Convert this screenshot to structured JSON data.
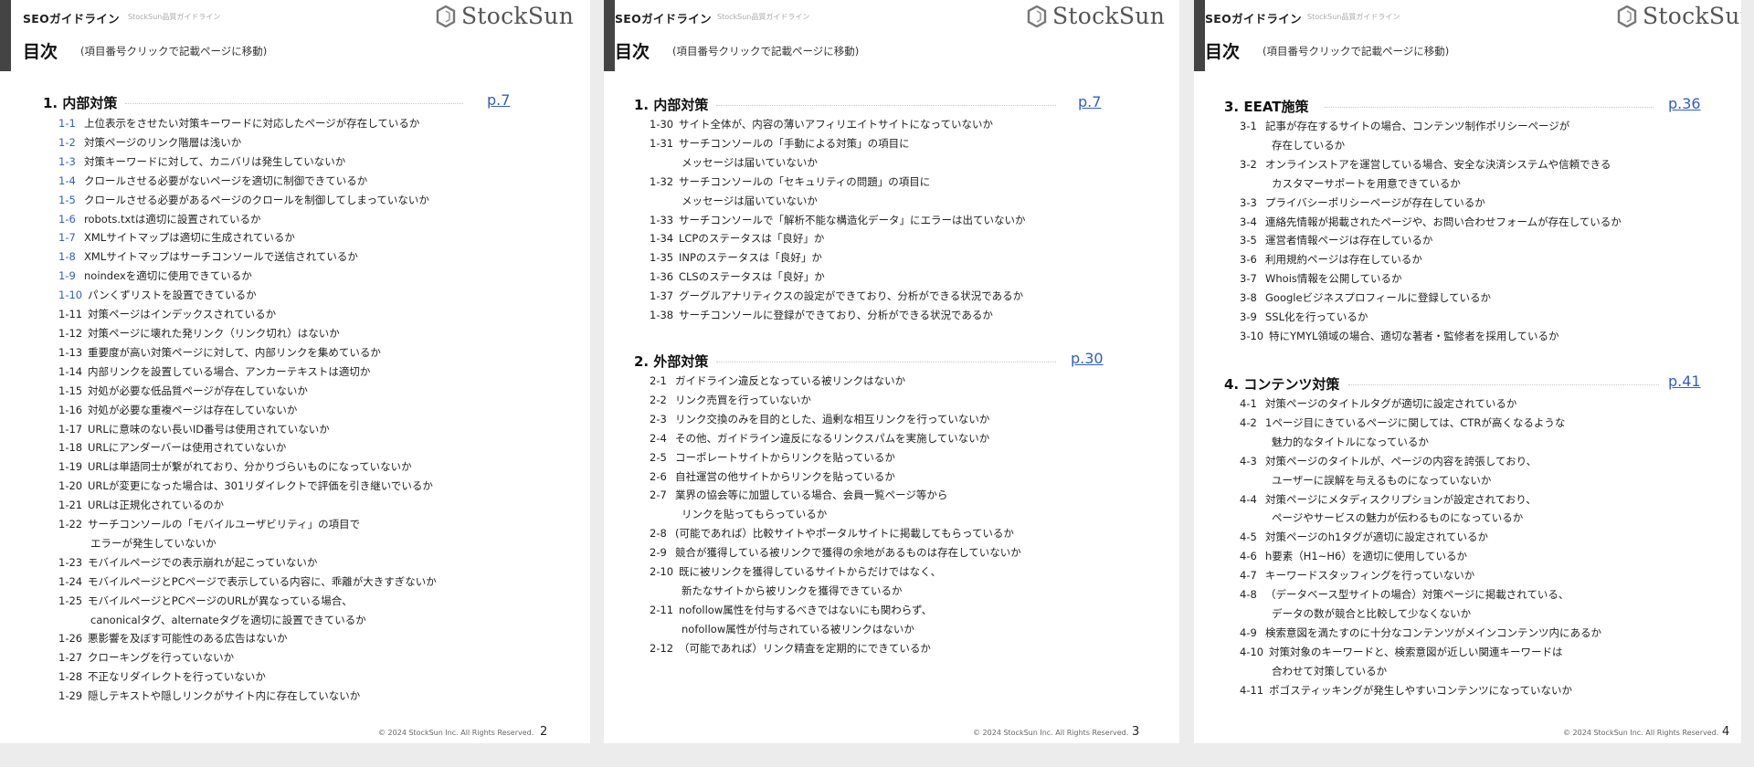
{
  "pages": [
    {
      "brand_title": "SEOガイドライン",
      "brand_sub": "StockSun品質ガイドライン",
      "logo_text": "StockSun",
      "heading": "目次",
      "heading_note": "(項目番号クリックで記載ページに移動)",
      "footer": "© 2024 StockSun Inc. All Rights Reserved.",
      "page_number": "2",
      "sections": [
        {
          "title": "1. 内部対策",
          "page": "p.7",
          "items": [
            {
              "num": "1-1",
              "text": "上位表示をさせたい対策キーワードに対応したページが存在しているか",
              "linked": true
            },
            {
              "num": "1-2",
              "text": "対策ページのリンク階層は浅いか",
              "linked": true
            },
            {
              "num": "1-3",
              "text": "対策キーワードに対して、カニバリは発生していないか",
              "linked": true
            },
            {
              "num": "1-4",
              "text": "クロールさせる必要がないページを適切に制御できているか",
              "linked": true
            },
            {
              "num": "1-5",
              "text": "クロールさせる必要があるページのクロールを制御してしまっていないか",
              "linked": true
            },
            {
              "num": "1-6",
              "text": "robots.txtは適切に設置されているか",
              "linked": true
            },
            {
              "num": "1-7",
              "text": "XMLサイトマップは適切に生成されているか",
              "linked": true
            },
            {
              "num": "1-8",
              "text": "XMLサイトマップはサーチコンソールで送信されているか",
              "linked": true
            },
            {
              "num": "1-9",
              "text": "noindexを適切に使用できているか",
              "linked": true
            },
            {
              "num": "1-10",
              "text": "パンくずリストを設置できているか",
              "linked": true
            },
            {
              "num": "1-11",
              "text": "対策ページはインデックスされているか",
              "linked": false
            },
            {
              "num": "1-12",
              "text": "対策ページに壊れた発リンク（リンク切れ）はないか",
              "linked": false
            },
            {
              "num": "1-13",
              "text": "重要度が高い対策ページに対して、内部リンクを集めているか",
              "linked": false
            },
            {
              "num": "1-14",
              "text": "内部リンクを設置している場合、アンカーテキストは適切か",
              "linked": false
            },
            {
              "num": "1-15",
              "text": "対処が必要な低品質ページが存在していないか",
              "linked": false
            },
            {
              "num": "1-16",
              "text": "対処が必要な重複ページは存在していないか",
              "linked": false
            },
            {
              "num": "1-17",
              "text": "URLに意味のない長いID番号は使用されていないか",
              "linked": false
            },
            {
              "num": "1-18",
              "text": "URLにアンダーバーは使用されていないか",
              "linked": false
            },
            {
              "num": "1-19",
              "text": "URLは単語同士が繋がれており、分かりづらいものになっていないか",
              "linked": false
            },
            {
              "num": "1-20",
              "text": "URLが変更になった場合は、301リダイレクトで評価を引き継いでいるか",
              "linked": false
            },
            {
              "num": "1-21",
              "text": "URLは正規化されているのか",
              "linked": false
            },
            {
              "num": "1-22",
              "text": "サーチコンソールの「モバイルユーザビリティ」の項目で",
              "linked": false
            },
            {
              "num": "",
              "text": "エラーが発生していないか",
              "linked": false
            },
            {
              "num": "1-23",
              "text": "モバイルページでの表示崩れが起こっていないか",
              "linked": false
            },
            {
              "num": "1-24",
              "text": "モバイルページとPCページで表示している内容に、乖離が大きすぎないか",
              "linked": false
            },
            {
              "num": "1-25",
              "text": "モバイルページとPCページのURLが異なっている場合、",
              "linked": false
            },
            {
              "num": "",
              "text": "canonicalタグ、alternateタグを適切に設置できているか",
              "linked": false
            },
            {
              "num": "1-26",
              "text": "悪影響を及ぼす可能性のある広告はないか",
              "linked": false
            },
            {
              "num": "1-27",
              "text": "クローキングを行っていないか",
              "linked": false
            },
            {
              "num": "1-28",
              "text": "不正なリダイレクトを行っていないか",
              "linked": false
            },
            {
              "num": "1-29",
              "text": "隠しテキストや隠しリンクがサイト内に存在していないか",
              "linked": false
            }
          ]
        }
      ]
    },
    {
      "brand_title": "SEOガイドライン",
      "brand_sub": "StockSun品質ガイドライン",
      "logo_text": "StockSun",
      "heading": "目次",
      "heading_note": "(項目番号クリックで記載ページに移動)",
      "footer": "© 2024 StockSun Inc. All Rights Reserved.",
      "page_number": "3",
      "sections": [
        {
          "title": "1. 内部対策",
          "page": "p.7",
          "items": [
            {
              "num": "1-30",
              "text": "サイト全体が、内容の薄いアフィリエイトサイトになっていないか",
              "linked": false
            },
            {
              "num": "1-31",
              "text": "サーチコンソールの「手動による対策」の項目に",
              "linked": false
            },
            {
              "num": "",
              "text": "メッセージは届いていないか",
              "linked": false
            },
            {
              "num": "1-32",
              "text": "サーチコンソールの「セキュリティの問題」の項目に",
              "linked": false
            },
            {
              "num": "",
              "text": "メッセージは届いていないか",
              "linked": false
            },
            {
              "num": "1-33",
              "text": "サーチコンソールで「解析不能な構造化データ」にエラーは出ていないか",
              "linked": false
            },
            {
              "num": "1-34",
              "text": "LCPのステータスは「良好」か",
              "linked": false
            },
            {
              "num": "1-35",
              "text": "INPのステータスは「良好」か",
              "linked": false
            },
            {
              "num": "1-36",
              "text": "CLSのステータスは「良好」か",
              "linked": false
            },
            {
              "num": "1-37",
              "text": "グーグルアナリティクスの設定ができており、分析ができる状況であるか",
              "linked": false
            },
            {
              "num": "1-38",
              "text": "サーチコンソールに登録ができており、分析ができる状況であるか",
              "linked": false
            }
          ]
        },
        {
          "title": "2. 外部対策",
          "page": "p.30",
          "items": [
            {
              "num": "2-1",
              "text": "ガイドライン違反となっている被リンクはないか",
              "linked": false
            },
            {
              "num": "2-2",
              "text": "リンク売買を行っていないか",
              "linked": false
            },
            {
              "num": "2-3",
              "text": "リンク交換のみを目的とした、過剰な相互リンクを行っていないか",
              "linked": false
            },
            {
              "num": "2-4",
              "text": "その他、ガイドライン違反になるリンクスパムを実施していないか",
              "linked": false
            },
            {
              "num": "2-5",
              "text": "コーポレートサイトからリンクを貼っているか",
              "linked": false
            },
            {
              "num": "2-6",
              "text": "自社運営の他サイトからリンクを貼っているか",
              "linked": false
            },
            {
              "num": "2-7",
              "text": "業界の協会等に加盟している場合、会員一覧ページ等から",
              "linked": false
            },
            {
              "num": "",
              "text": "リンクを貼ってもらっているか",
              "linked": false
            },
            {
              "num": "2-8",
              "text": "(可能であれば）比較サイトやポータルサイトに掲載してもらっているか",
              "linked": false
            },
            {
              "num": "2-9",
              "text": "競合が獲得している被リンクで獲得の余地があるものは存在していないか",
              "linked": false
            },
            {
              "num": "2-10",
              "text": "既に被リンクを獲得しているサイトからだけではなく、",
              "linked": false
            },
            {
              "num": "",
              "text": "新たなサイトから被リンクを獲得できているか",
              "linked": false
            },
            {
              "num": "2-11",
              "text": "nofollow属性を付与するべきではないにも関わらず、",
              "linked": false
            },
            {
              "num": "",
              "text": "nofollow属性が付与されている被リンクはないか",
              "linked": false
            },
            {
              "num": "2-12",
              "text": "（可能であれば）リンク精査を定期的にできているか",
              "linked": false
            }
          ]
        }
      ]
    },
    {
      "brand_title": "SEOガイドライン",
      "brand_sub": "StockSun品質ガイドライン",
      "logo_text": "StockSun",
      "heading": "目次",
      "heading_note": "(項目番号クリックで記載ページに移動)",
      "footer": "© 2024 StockSun Inc. All Rights Reserved.",
      "page_number": "4",
      "sections": [
        {
          "title": "3. EEAT施策",
          "page": "p.36",
          "items": [
            {
              "num": "3-1",
              "text": "記事が存在するサイトの場合、コンテンツ制作ポリシーページが",
              "linked": false
            },
            {
              "num": "",
              "text": "存在しているか",
              "linked": false
            },
            {
              "num": "3-2",
              "text": "オンラインストアを運営している場合、安全な決済システムや信頼できる",
              "linked": false
            },
            {
              "num": "",
              "text": "カスタマーサポートを用意できているか",
              "linked": false
            },
            {
              "num": "3-3",
              "text": "プライバシーポリシーページが存在しているか",
              "linked": false
            },
            {
              "num": "3-4",
              "text": "連絡先情報が掲載されたページや、お問い合わせフォームが存在しているか",
              "linked": false
            },
            {
              "num": "3-5",
              "text": "運営者情報ページは存在しているか",
              "linked": false
            },
            {
              "num": "3-6",
              "text": "利用規約ページは存在しているか",
              "linked": false
            },
            {
              "num": "3-7",
              "text": "Whois情報を公開しているか",
              "linked": false
            },
            {
              "num": "3-8",
              "text": "Googleビジネスプロフィールに登録しているか",
              "linked": false
            },
            {
              "num": "3-9",
              "text": "SSL化を行っているか",
              "linked": false
            },
            {
              "num": "3-10",
              "text": "特にYMYL領域の場合、適切な著者・監修者を採用しているか",
              "linked": false
            }
          ]
        },
        {
          "title": "4. コンテンツ対策",
          "page": "p.41",
          "items": [
            {
              "num": "4-1",
              "text": "対策ページのタイトルタグが適切に設定されているか",
              "linked": false
            },
            {
              "num": "4-2",
              "text": "1ページ目にきているページに関しては、CTRが高くなるような",
              "linked": false
            },
            {
              "num": "",
              "text": "魅力的なタイトルになっているか",
              "linked": false
            },
            {
              "num": "4-3",
              "text": "対策ページのタイトルが、ページの内容を誇張しており、",
              "linked": false
            },
            {
              "num": "",
              "text": "ユーザーに誤解を与えるものになっていないか",
              "linked": false
            },
            {
              "num": "4-4",
              "text": "対策ページにメタディスクリプションが設定されており、",
              "linked": false
            },
            {
              "num": "",
              "text": "ページやサービスの魅力が伝わるものになっているか",
              "linked": false
            },
            {
              "num": "4-5",
              "text": "対策ページのh1タグが適切に設定されているか",
              "linked": false
            },
            {
              "num": "4-6",
              "text": "h要素（H1~H6）を適切に使用しているか",
              "linked": false
            },
            {
              "num": "4-7",
              "text": "キーワードスタッフィングを行っていないか",
              "linked": false
            },
            {
              "num": "4-8",
              "text": "（データベース型サイトの場合）対策ページに掲載されている、",
              "linked": false
            },
            {
              "num": "",
              "text": "データの数が競合と比較して少なくないか",
              "linked": false
            },
            {
              "num": "4-9",
              "text": "検索意図を満たすのに十分なコンテンツがメインコンテンツ内にあるか",
              "linked": false
            },
            {
              "num": "4-10",
              "text": "対策対象のキーワードと、検索意図が近しい関連キーワードは",
              "linked": false
            },
            {
              "num": "",
              "text": "合わせて対策しているか",
              "linked": false
            },
            {
              "num": "4-11",
              "text": "ポゴスティッキングが発生しやすいコンテンツになっていないか",
              "linked": false
            }
          ]
        }
      ]
    }
  ]
}
